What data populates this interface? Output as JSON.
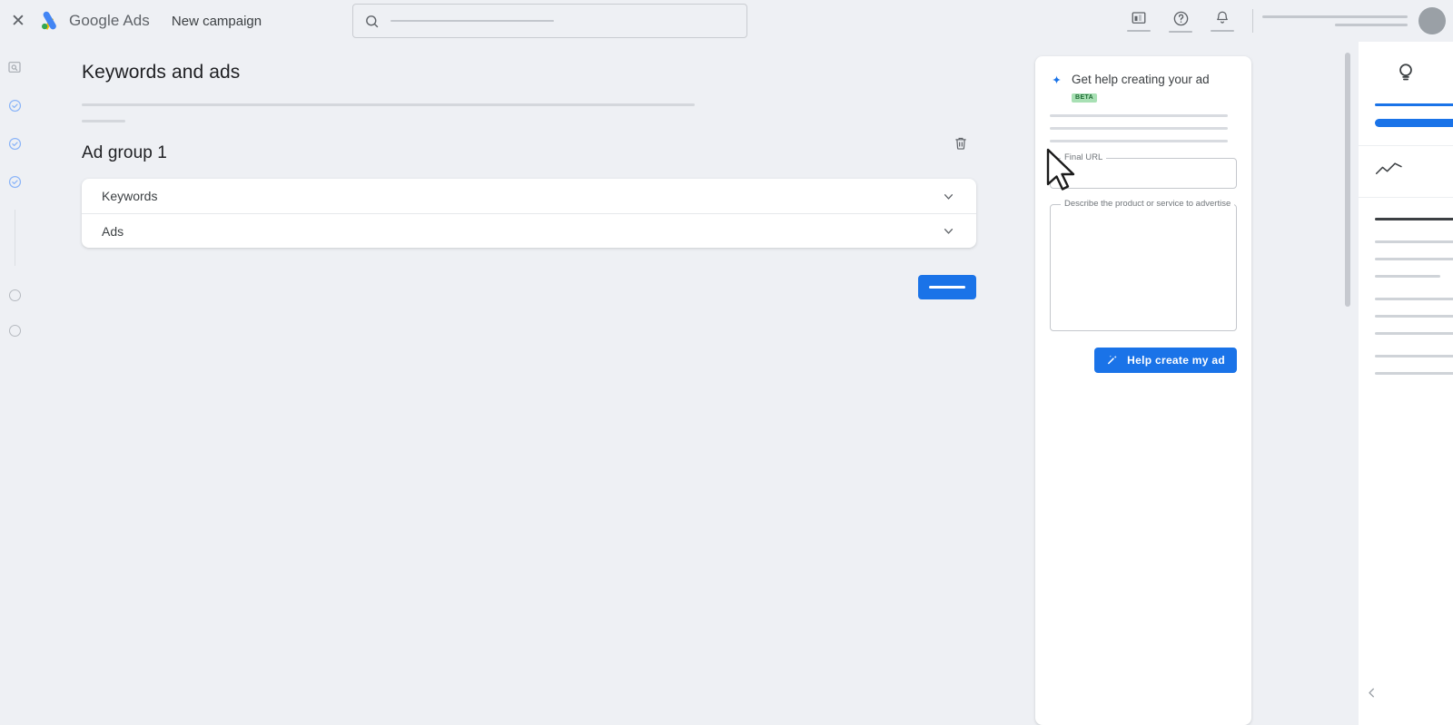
{
  "topbar": {
    "close_label": "✕",
    "brand_primary": "Google",
    "brand_secondary": "Ads",
    "page_context": "New campaign",
    "search_placeholder": "",
    "icons": {
      "search": "search-icon",
      "reports": "reports-icon",
      "help": "help-icon",
      "notifications": "bell-icon",
      "avatar": "avatar"
    }
  },
  "rail": {
    "icons": [
      "campaign-goal-icon",
      "step-complete-1",
      "step-complete-2",
      "step-complete-3",
      "step-pending-1",
      "step-pending-2"
    ]
  },
  "main": {
    "heading": "Keywords and ads",
    "ad_group_title": "Ad group 1",
    "delete_icon_name": "trash-icon",
    "accordion": [
      {
        "label": "Keywords",
        "expanded": false
      },
      {
        "label": "Ads",
        "expanded": false
      }
    ],
    "primary_button_label": ""
  },
  "assist": {
    "title": "Get help creating your ad",
    "badge": "BETA",
    "sparkle_icon": "sparkle-icon",
    "final_url_label": "Final URL",
    "final_url_value": "",
    "description_label": "Describe the product or service to advertise",
    "description_value": "",
    "cta_label": "Help create my ad",
    "cta_icon": "magic-wand-icon"
  },
  "right_panel": {
    "top_icon": "lightbulb-icon",
    "chart_icon": "trend-line-icon",
    "collapse_icon": "chevron-left-icon"
  },
  "colors": {
    "accent_blue": "#1a73e8",
    "page_bg": "#eef0f4",
    "card_bg": "#ffffff",
    "badge_green": "#a8e0b4",
    "text_primary": "#202124",
    "text_secondary": "#5f6368"
  }
}
